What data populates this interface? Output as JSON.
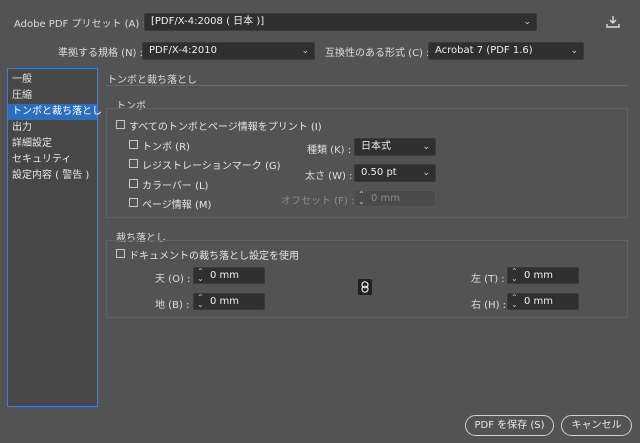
{
  "header": {
    "preset_label": "Adobe PDF プリセット (A) :",
    "preset_value": "[PDF/X-4:2008 ( 日本 )]",
    "standard_label": "準拠する規格 (N) :",
    "standard_value": "PDF/X-4:2010",
    "compat_label": "互換性のある形式 (C) :",
    "compat_value": "Acrobat 7 (PDF 1.6)"
  },
  "sidebar": {
    "items": [
      "一般",
      "圧縮",
      "トンボと裁ち落とし",
      "出力",
      "詳細設定",
      "セキュリティ",
      "設定内容 ( 警告 )"
    ],
    "selected_index": 2
  },
  "section_title": "トンボと裁ち落とし",
  "marks": {
    "group_title": "トンボ",
    "all_marks": "すべてのトンボとページ情報をプリント (I)",
    "trim_marks": "トンボ (R)",
    "registration_marks": "レジストレーションマーク (G)",
    "color_bars": "カラーバー (L)",
    "page_info": "ページ情報 (M)",
    "type_label": "種類 (K) :",
    "type_value": "日本式",
    "weight_label": "太さ (W) :",
    "weight_value": "0.50 pt",
    "offset_label": "オフセット (F) :",
    "offset_value": "0 mm"
  },
  "bleed": {
    "group_title": "裁ち落とし",
    "use_doc": "ドキュメントの裁ち落とし設定を使用",
    "top_label": "天 (O) :",
    "top_value": "0 mm",
    "bottom_label": "地 (B) :",
    "bottom_value": "0 mm",
    "left_label": "左 (T) :",
    "left_value": "0 mm",
    "right_label": "右 (H) :",
    "right_value": "0 mm"
  },
  "buttons": {
    "save": "PDF を保存 (S)",
    "cancel": "キャンセル"
  },
  "icons": {
    "chevron": "⌄",
    "spinner": "⌃⌄",
    "link": "chain-link-icon",
    "save_preset": "save-preset-icon"
  }
}
